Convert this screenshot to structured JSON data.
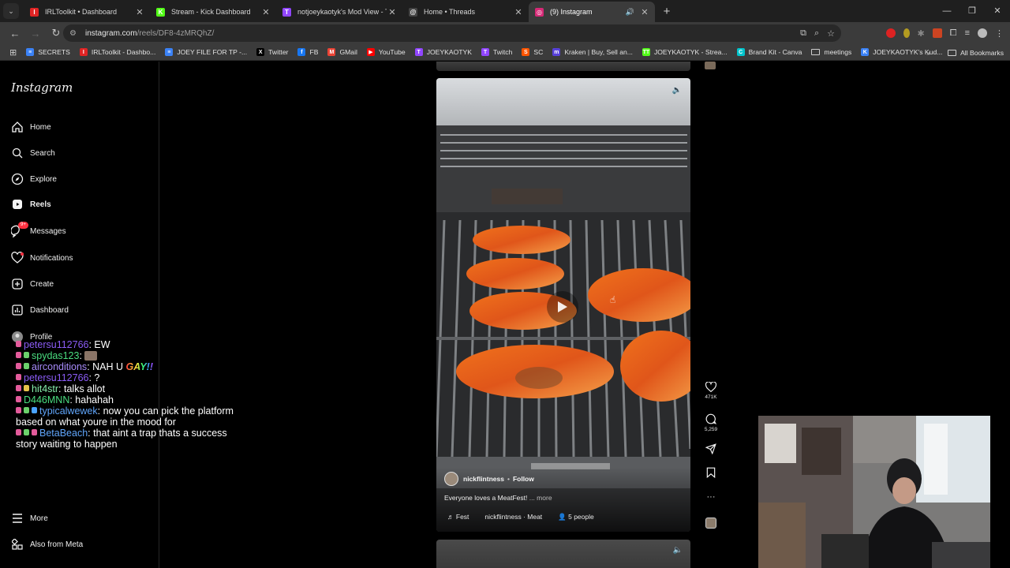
{
  "browser": {
    "tabs": [
      {
        "title": "IRLToolkit • Dashboard",
        "color": "#e02424",
        "glyph": "I",
        "active": false
      },
      {
        "title": "Stream - Kick Dashboard",
        "color": "#53fc18",
        "glyph": "K",
        "active": false
      },
      {
        "title": "notjoeykaotyk's Mod View - Tw",
        "color": "#9146ff",
        "glyph": "T",
        "active": false
      },
      {
        "title": "Home • Threads",
        "color": "#444444",
        "glyph": "@",
        "active": false
      },
      {
        "title": "(9) Instagram",
        "color": "#d62976",
        "glyph": "◎",
        "active": true
      }
    ],
    "url_host": "instagram.com",
    "url_path": "/reels/DF8-4zMRQhZ/",
    "bookmarks": [
      {
        "label": "SECRETS",
        "color": "#3b82f6",
        "glyph": "≡"
      },
      {
        "label": "IRLToolkit - Dashbo...",
        "color": "#e02424",
        "glyph": "I"
      },
      {
        "label": "JOEY FILE FOR TP -...",
        "color": "#3b82f6",
        "glyph": "≡"
      },
      {
        "label": "Twitter",
        "color": "#000000",
        "glyph": "X"
      },
      {
        "label": "FB",
        "color": "#1877f2",
        "glyph": "f"
      },
      {
        "label": "GMail",
        "color": "#ea4335",
        "glyph": "M"
      },
      {
        "label": "YouTube",
        "color": "#ff0000",
        "glyph": "▶"
      },
      {
        "label": "JOEYKAOTYK",
        "color": "#9146ff",
        "glyph": "T"
      },
      {
        "label": "Twitch",
        "color": "#9146ff",
        "glyph": "T"
      },
      {
        "label": "SC",
        "color": "#ff5500",
        "glyph": "S"
      },
      {
        "label": "Kraken | Buy, Sell an...",
        "color": "#5741d9",
        "glyph": "m"
      },
      {
        "label": "JOEYKAOTYK - Strea...",
        "color": "#53fc18",
        "glyph": "TT"
      },
      {
        "label": "Brand Kit - Canva",
        "color": "#00c4cc",
        "glyph": "C"
      },
      {
        "label": "meetings",
        "color": "",
        "glyph": "folder"
      },
      {
        "label": "JOEYKAOTYK's Kud...",
        "color": "#3b82f6",
        "glyph": "K"
      }
    ],
    "all_bookmarks": "All Bookmarks"
  },
  "instagram": {
    "logo": "Instagram",
    "nav": [
      {
        "label": "Home",
        "icon": "home-icon"
      },
      {
        "label": "Search",
        "icon": "search-icon"
      },
      {
        "label": "Explore",
        "icon": "compass-icon"
      },
      {
        "label": "Reels",
        "icon": "reels-icon"
      },
      {
        "label": "Messages",
        "icon": "messenger-icon",
        "badge": "9+"
      },
      {
        "label": "Notifications",
        "icon": "heart-icon"
      },
      {
        "label": "Create",
        "icon": "plus-square-icon"
      },
      {
        "label": "Dashboard",
        "icon": "bar-chart-icon"
      },
      {
        "label": "Profile",
        "icon": "avatar-icon"
      }
    ],
    "more": "More",
    "also_from_meta": "Also from Meta",
    "reel": {
      "username": "nickflintness",
      "follow": "Follow",
      "caption": "Everyone loves a MeatFest!",
      "more": "... more",
      "audio": "Fest",
      "audio_credit": "nickflintness · Meat",
      "people": "5 people"
    },
    "actions": {
      "likes": "471K",
      "comments": "5,259"
    }
  },
  "chat": [
    {
      "user": "petersu112766",
      "text": ": EW",
      "cls": "u1",
      "pills": [
        "p"
      ]
    },
    {
      "user": "spydas123",
      "text": ":",
      "cls": "u2",
      "pills": [
        "p",
        "g"
      ],
      "emote": true
    },
    {
      "user": "airconditions",
      "text": ": NAH U ",
      "cls": "u3",
      "pills": [
        "p",
        "g"
      ],
      "rainbow": "GAY!!"
    },
    {
      "user": "petersu112766",
      "text": ": ?",
      "cls": "u1",
      "pills": [
        "p"
      ]
    },
    {
      "user": "hit4str",
      "text": ": talks allot",
      "cls": "u4",
      "pills": [
        "p",
        "y"
      ]
    },
    {
      "user": "D446MNN",
      "text": ": hahahah",
      "cls": "u5",
      "pills": [
        "p"
      ]
    },
    {
      "user": "typicalwewek",
      "text": ": now you can pick the platform based on what youre in the mood for",
      "cls": "u6",
      "pills": [
        "p",
        "g",
        "b"
      ]
    },
    {
      "user": "BetaBeach",
      "text": ": that aint a trap thats a success story waiting to happen",
      "cls": "u7",
      "pills": [
        "p",
        "g",
        "p"
      ]
    }
  ]
}
